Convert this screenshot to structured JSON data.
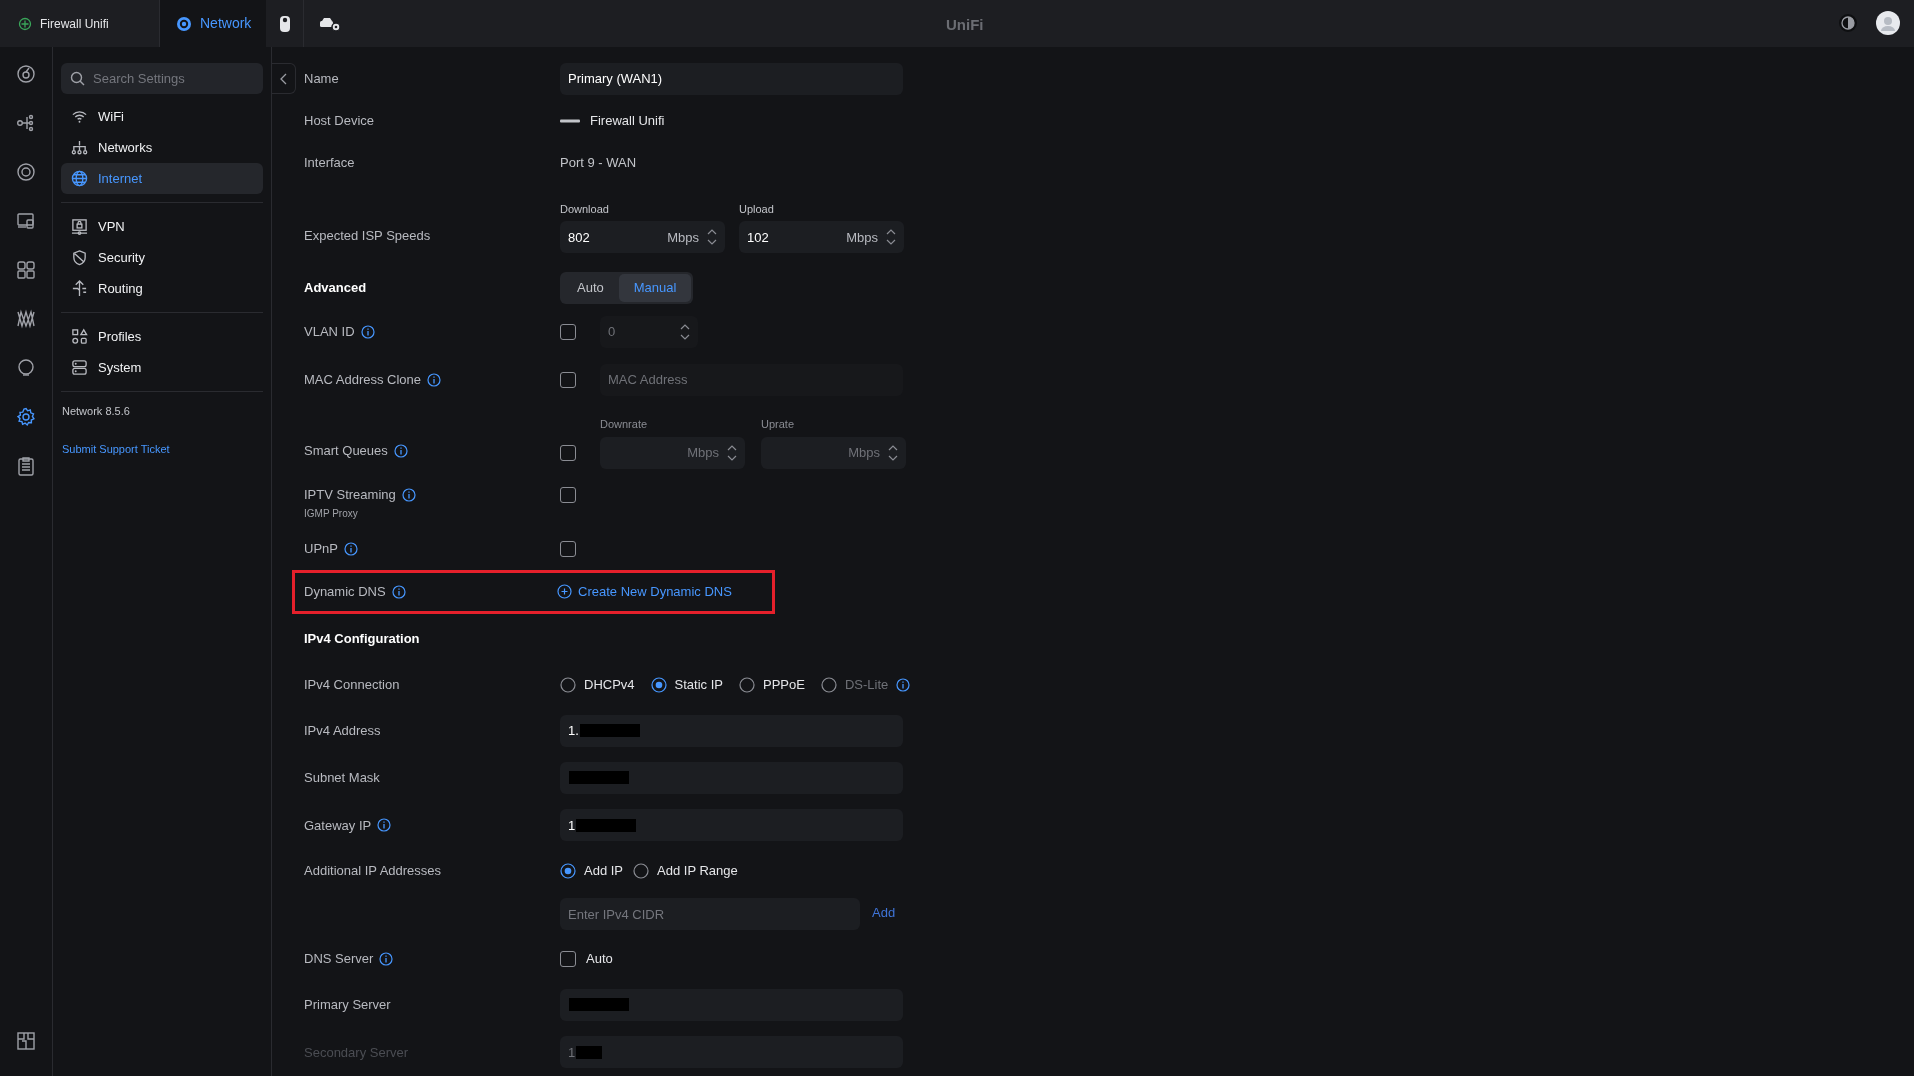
{
  "top_bar": {
    "tabs": [
      {
        "label": "Firewall Unifi",
        "kind": "site",
        "selected": false
      },
      {
        "label": "Network",
        "kind": "network",
        "selected": true
      }
    ],
    "apps": [
      {
        "kind": "camera"
      },
      {
        "kind": "gateway"
      }
    ],
    "title": "UniFi"
  },
  "icon_rail": [
    {
      "kind": "dashboard",
      "selected": false
    },
    {
      "kind": "topology",
      "selected": false
    },
    {
      "kind": "devices",
      "selected": false
    },
    {
      "kind": "clients",
      "selected": false
    },
    {
      "kind": "ports",
      "selected": false
    },
    {
      "kind": "insights",
      "selected": false
    },
    {
      "kind": "alerts",
      "selected": false
    },
    {
      "kind": "settings",
      "selected": true
    },
    {
      "kind": "logs",
      "selected": false
    }
  ],
  "settings_nav": {
    "search_placeholder": "Search Settings",
    "groups": [
      [
        {
          "label": "WiFi",
          "kind": "wifi",
          "selected": false
        },
        {
          "label": "Networks",
          "kind": "networks",
          "selected": false
        },
        {
          "label": "Internet",
          "kind": "globe",
          "selected": true
        }
      ],
      [
        {
          "label": "VPN",
          "kind": "vpn",
          "selected": false
        },
        {
          "label": "Security",
          "kind": "shield",
          "selected": false
        },
        {
          "label": "Routing",
          "kind": "routing",
          "selected": false
        }
      ],
      [
        {
          "label": "Profiles",
          "kind": "profiles",
          "selected": false
        },
        {
          "label": "System",
          "kind": "system",
          "selected": false
        }
      ]
    ],
    "version": "Network 8.5.6",
    "support_link": "Submit Support Ticket"
  },
  "form": [
    {
      "kind": "text_field",
      "label": "Name",
      "info": false,
      "value": "Primary (WAN1)"
    },
    {
      "kind": "device",
      "label": "Host Device",
      "info": false,
      "value": "Firewall Unifi"
    },
    {
      "kind": "text",
      "label": "Interface",
      "info": false,
      "value": "Port 9 - WAN"
    },
    {
      "kind": "speeds",
      "label": "Expected ISP Speeds",
      "info": false,
      "fields": [
        {
          "caption": "Download",
          "value": "802",
          "unit": "Mbps"
        },
        {
          "caption": "Upload",
          "value": "102",
          "unit": "Mbps"
        }
      ]
    },
    {
      "kind": "segmented",
      "label": "Advanced",
      "info": false,
      "options": [
        {
          "label": "Auto",
          "selected": false
        },
        {
          "label": "Manual",
          "selected": true
        }
      ]
    },
    {
      "kind": "checkbox_stepper",
      "label": "VLAN ID",
      "info": true,
      "checked": false,
      "value": "0"
    },
    {
      "kind": "checkbox_field",
      "label": "MAC Address Clone",
      "info": true,
      "checked": false,
      "placeholder": "MAC Address"
    },
    {
      "kind": "checkbox_speeds",
      "label": "Smart Queues",
      "info": true,
      "checked": false,
      "fields": [
        {
          "caption": "Downrate",
          "unit": "Mbps"
        },
        {
          "caption": "Uprate",
          "unit": "Mbps"
        }
      ]
    },
    {
      "kind": "checkbox",
      "label": "IPTV Streaming",
      "sublabel": "IGMP Proxy",
      "info": true,
      "checked": false
    },
    {
      "kind": "checkbox",
      "label": "UPnP",
      "info": true,
      "checked": false
    },
    {
      "kind": "link",
      "label": "Dynamic DNS",
      "info": true,
      "link": "Create New Dynamic DNS",
      "highlighted": true
    },
    {
      "kind": "heading",
      "label": "IPv4 Configuration"
    },
    {
      "kind": "radios",
      "label": "IPv4 Connection",
      "info": false,
      "options": [
        {
          "label": "DHCPv4",
          "selected": false,
          "disabled": false,
          "info": false
        },
        {
          "label": "Static IP",
          "selected": true,
          "disabled": false,
          "info": false
        },
        {
          "label": "PPPoE",
          "selected": false,
          "disabled": false,
          "info": false
        },
        {
          "label": "DS-Lite",
          "selected": false,
          "disabled": true,
          "info": true
        }
      ]
    },
    {
      "kind": "masked_field",
      "label": "IPv4 Address",
      "info": false,
      "disabled": false,
      "value": "1."
    },
    {
      "kind": "masked_field",
      "label": "Subnet Mask",
      "info": false,
      "disabled": false
    },
    {
      "kind": "masked_field",
      "label": "Gateway IP",
      "info": true,
      "disabled": false,
      "value": "1"
    },
    {
      "kind": "radios",
      "label": "Additional IP Addresses",
      "info": false,
      "options": [
        {
          "label": "Add IP",
          "selected": true,
          "disabled": false,
          "info": false
        },
        {
          "label": "Add IP Range",
          "selected": false,
          "disabled": false,
          "info": false
        }
      ]
    },
    {
      "kind": "cidr",
      "placeholder": "Enter IPv4 CIDR",
      "button": "Add"
    },
    {
      "kind": "checkbox_text",
      "label": "DNS Server",
      "info": true,
      "checked": false,
      "text": "Auto"
    },
    {
      "kind": "masked_field",
      "label": "Primary Server",
      "info": false,
      "disabled": false
    },
    {
      "kind": "masked_field",
      "label": "Secondary Server",
      "info": false,
      "disabled": true,
      "value": "1"
    }
  ]
}
